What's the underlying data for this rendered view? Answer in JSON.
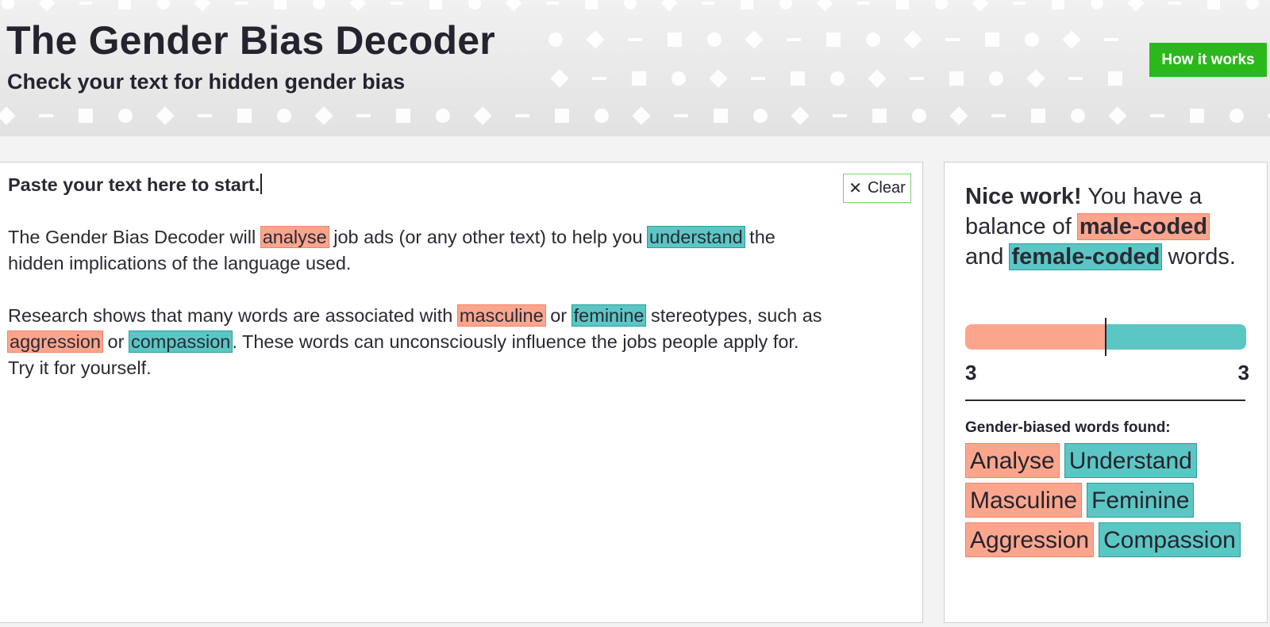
{
  "header": {
    "title": "The Gender Bias Decoder",
    "subtitle": "Check your text for hidden gender bias",
    "how_it_works_label": "How it works"
  },
  "editor": {
    "clear_label": "Clear",
    "clear_icon": "close-icon",
    "lead": "Paste your text here to start.",
    "p1": {
      "t1": "The Gender Bias Decoder will ",
      "w1": "analyse",
      "t2": " job ads (or any other text) to help you ",
      "w2": "understand",
      "t3": " the hidden implications of the language used."
    },
    "p2": {
      "t1": "Research shows that many words are associated with ",
      "w1": "masculine",
      "t2": " or ",
      "w2": "feminine",
      "t3": " stereotypes, such as ",
      "w3": "aggression",
      "t4": " or ",
      "w4": "compassion",
      "t5": ". These words can unconsciously influence the jobs people apply for. Try it for yourself."
    }
  },
  "result": {
    "nice": "Nice work!",
    "s1": " You have a balance of ",
    "male_coded": "male-coded",
    "s2": " and ",
    "female_coded": "female-coded",
    "s3": " words.",
    "male_count": "3",
    "female_count": "3",
    "male_fraction": 0.5,
    "found_label": "Gender-biased words found:",
    "words": [
      {
        "label": "Analyse",
        "type": "male"
      },
      {
        "label": "Understand",
        "type": "female"
      },
      {
        "label": "Masculine",
        "type": "male"
      },
      {
        "label": "Feminine",
        "type": "female"
      },
      {
        "label": "Aggression",
        "type": "male"
      },
      {
        "label": "Compassion",
        "type": "female"
      }
    ]
  },
  "colors": {
    "male": "#fca58d",
    "female": "#5bc7c4",
    "accent": "#2bb81c"
  }
}
